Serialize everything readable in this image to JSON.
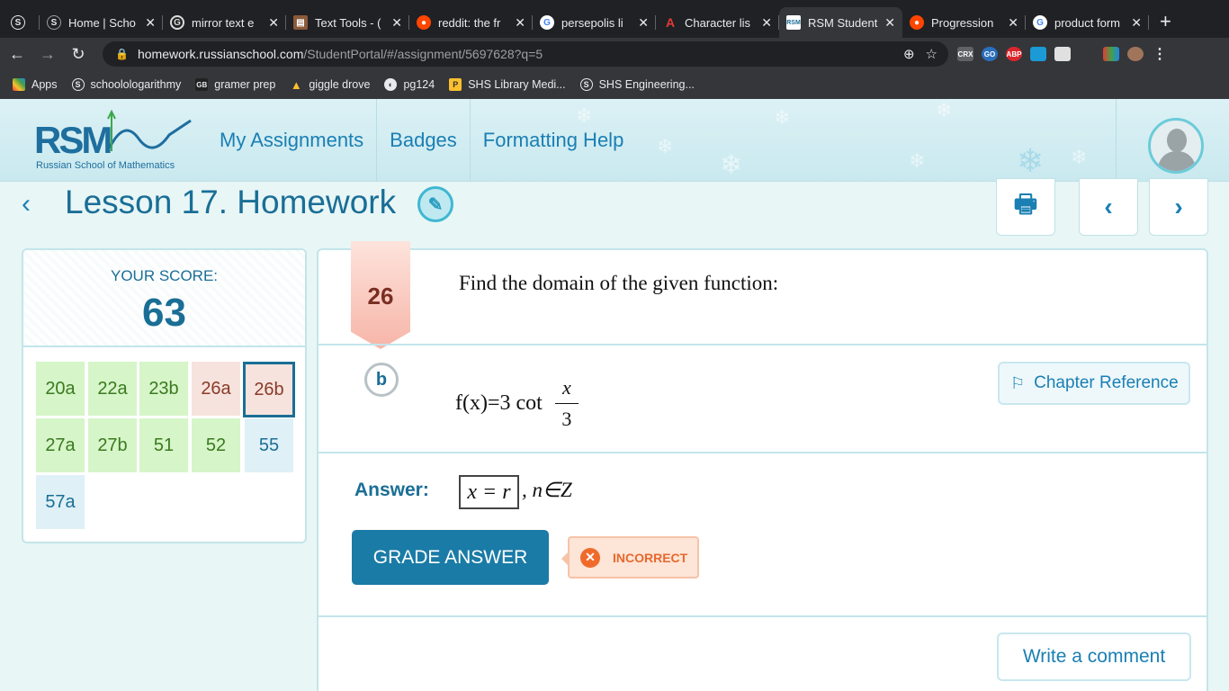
{
  "browser": {
    "tabs": [
      {
        "label": "",
        "icon": "schoology-icon"
      },
      {
        "label": "Home | Scho",
        "icon": "schoology-icon"
      },
      {
        "label": "mirror text e",
        "icon": "google-icon"
      },
      {
        "label": "Text Tools - (",
        "icon": "text-tools-icon"
      },
      {
        "label": "reddit: the fr",
        "icon": "reddit-icon"
      },
      {
        "label": "persepolis li",
        "icon": "google-icon"
      },
      {
        "label": "Character lis",
        "icon": "sparknotes-icon"
      },
      {
        "label": "RSM Student",
        "icon": "rsm-icon",
        "active": true
      },
      {
        "label": "Progression",
        "icon": "reddit-icon"
      },
      {
        "label": "product form",
        "icon": "google-icon"
      }
    ],
    "new_tab": "+",
    "url_domain": "homework.russianschool.com",
    "url_path": "/StudentPortal/#/assignment/5697628?q=5",
    "extensions": [
      "CRX",
      "GO",
      "ABP",
      "",
      "",
      "",
      ""
    ],
    "bookmarks": [
      {
        "label": "Apps",
        "icon": "apps-icon"
      },
      {
        "label": "schoolologarithmy",
        "icon": "schoology-icon"
      },
      {
        "label": "gramer prep",
        "icon": "gb-icon"
      },
      {
        "label": "giggle drove",
        "icon": "drive-icon"
      },
      {
        "label": "pg124",
        "icon": "globe-icon"
      },
      {
        "label": "SHS Library Medi...",
        "icon": "library-icon"
      },
      {
        "label": "SHS Engineering...",
        "icon": "schoology-icon"
      }
    ]
  },
  "site": {
    "logo_text": "RSM",
    "logo_subtitle": "Russian School of Mathematics",
    "nav": [
      "My Assignments",
      "Badges",
      "Formatting Help"
    ]
  },
  "lesson": {
    "title": "Lesson 17. Homework"
  },
  "score": {
    "label": "YOUR SCORE:",
    "value": "63",
    "problems": [
      {
        "id": "20a",
        "status": "correct"
      },
      {
        "id": "22a",
        "status": "correct"
      },
      {
        "id": "23b",
        "status": "correct"
      },
      {
        "id": "26a",
        "status": "incorrect"
      },
      {
        "id": "26b",
        "status": "incorrect",
        "selected": true
      },
      {
        "id": "27a",
        "status": "correct"
      },
      {
        "id": "27b",
        "status": "correct"
      },
      {
        "id": "51",
        "status": "correct"
      },
      {
        "id": "52",
        "status": "correct"
      },
      {
        "id": "55",
        "status": "unanswered"
      },
      {
        "id": "57a",
        "status": "unanswered"
      }
    ]
  },
  "question": {
    "number": "26",
    "prompt": "Find the domain of the given function:",
    "part": "b",
    "formula_lhs": "f(x)=3 cot",
    "formula_num": "x",
    "formula_den": "3",
    "chapter_ref": "Chapter Reference",
    "answer_label": "Answer:",
    "answer_value": "x = r",
    "answer_suffix": ", n∈Z",
    "grade_button": "GRADE ANSWER",
    "result": "INCORRECT",
    "comment_button": "Write a comment"
  },
  "colors": {
    "accent": "#1a7fb3",
    "correct_bg": "#d6f5c8",
    "incorrect_bg": "#f6e3dd",
    "unanswered_bg": "#dff0f6",
    "incorrect_text": "#e8682e"
  }
}
